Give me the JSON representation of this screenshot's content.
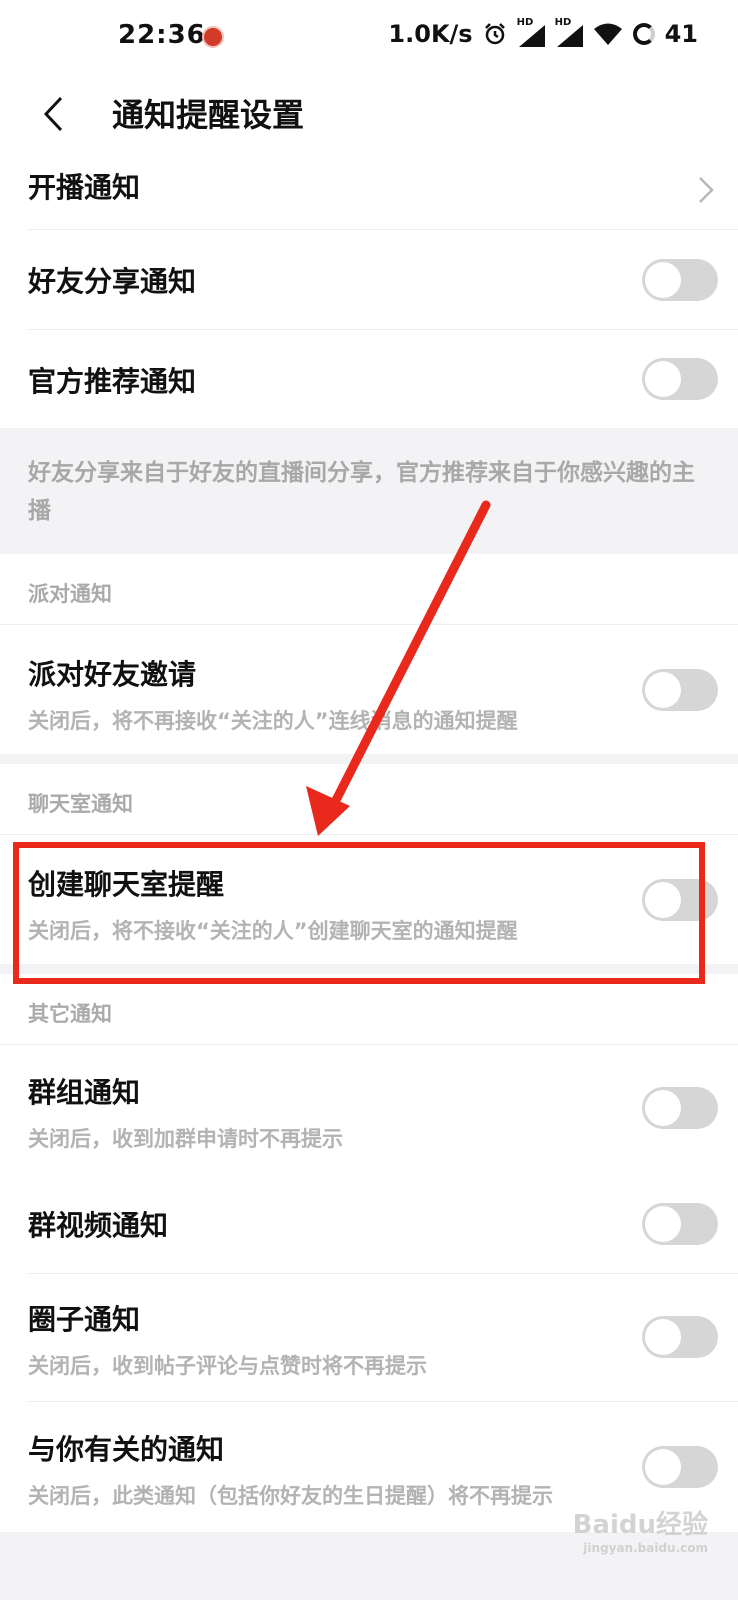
{
  "status_bar": {
    "time": "22:36",
    "speed": "1.0K/s",
    "hd1": "HD",
    "hd2": "HD",
    "battery": "41",
    "icons": [
      "app-notification-icon",
      "alarm-icon",
      "signal-icon",
      "signal-icon",
      "wifi-icon",
      "battery-icon"
    ]
  },
  "header": {
    "title": "通知提醒设置",
    "back_icon": "chevron-left-icon"
  },
  "rows": {
    "live": {
      "label": "开播通知"
    },
    "friend_share": {
      "label": "好友分享通知",
      "enabled": false
    },
    "official": {
      "label": "官方推荐通知",
      "enabled": false
    }
  },
  "note": "好友分享来自于好友的直播间分享，官方推荐来自于你感兴趣的主播",
  "sections": {
    "party": {
      "title": "派对通知",
      "item": {
        "label": "派对好友邀请",
        "sub": "关闭后，将不再接收“关注的人”连线消息的通知提醒",
        "enabled": false
      }
    },
    "chat": {
      "title": "聊天室通知",
      "item": {
        "label": "创建聊天室提醒",
        "sub": "关闭后，将不接收“关注的人”创建聊天室的通知提醒",
        "enabled": false
      }
    },
    "other": {
      "title": "其它通知",
      "group": {
        "label": "群组通知",
        "sub": "关闭后，收到加群申请时不再提示",
        "enabled": false
      },
      "group_video": {
        "label": "群视频通知",
        "enabled": false
      },
      "circle": {
        "label": "圈子通知",
        "sub": "关闭后，收到帖子评论与点赞时将不再提示",
        "enabled": false
      },
      "related": {
        "label": "与你有关的通知",
        "sub": "关闭后，此类通知（包括你好友的生日提醒）将不再提示",
        "enabled": false
      }
    }
  },
  "annotation": {
    "color": "#e8291c"
  },
  "watermark": {
    "text": "Baidu经验",
    "url": "jingyan.baidu.com"
  }
}
